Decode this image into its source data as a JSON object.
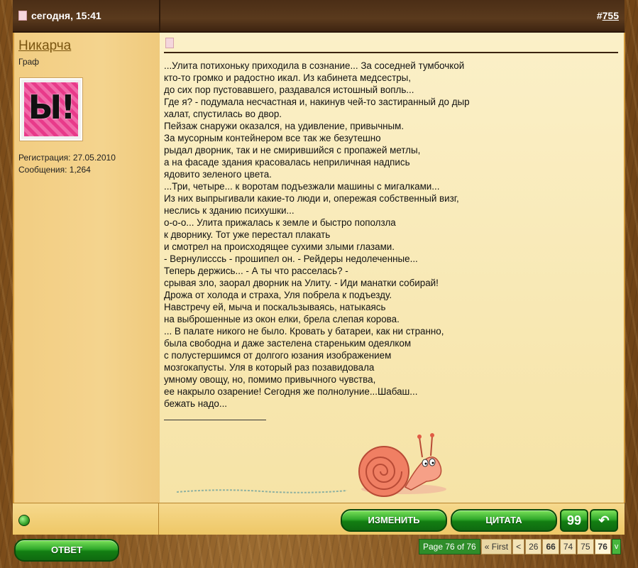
{
  "post": {
    "date": "сегодня, 15:41",
    "number_prefix": "#",
    "number": "755"
  },
  "user": {
    "name": "Никарча",
    "title": "Граф",
    "avatar_text": "Ы!",
    "registration": "Регистрация: 27.05.2010",
    "messages": "Сообщения: 1,264"
  },
  "body": {
    "lines": [
      "...Улита потихоньку приходила в сознание... За соседней тумбочкой",
      "кто-то громко и радостно икал. Из кабинета медсестры,",
      "до сих пор пустовавшего, раздавался истошный вопль...",
      "Где я? - подумала несчастная и, накинув чей-то застиранный до дыр",
      "халат, спустилась во двор.",
      "Пейзаж снаружи оказался, на удивление, привычным.",
      "За мусорным контейнером все так же безутешно",
      "рыдал дворник, так и не смирившийся с пропажей метлы,",
      "а на фасаде здания красовалась неприличная надпись",
      "ядовито зеленого цвета.",
      "...Три, четыре... к воротам подъезжали машины с мигалками...",
      "Из них выпрыгивали какие-то люди и, опережая собственный визг,",
      "неслись к зданию психушки...",
      "о-о-о... Улита прижалась к земле и быстро поползла",
      "к дворнику. Тот уже перестал плакать",
      "и смотрел на происходящее сухими злыми глазами.",
      "- Вернулисссь - прошипел он. - Рейдеры недолеченные...",
      "Теперь держись... - А ты что расселась? -",
      "срывая зло, заорал дворник на Улиту. - Иди манатки собирай!",
      "Дрожа от холода и страха, Уля побрела к подъезду.",
      "Навстречу ей, мыча и поскальзываясь, натыкаясь",
      "на выброшенные из окон елки, брела слепая корова.",
      "... В палате никого не было. Кровать у батареи, как ни странно,",
      "была свободна и даже застелена стареньким одеялком",
      "с полустершимся от долгого юзания изображением",
      "мозгокапусты. Уля в который раз позавидовала",
      "умному овощу, но, помимо привычного чувства,",
      "ее накрыло озарение! Сегодня же полнолуние...Шабаш...",
      "бежать надо..."
    ]
  },
  "buttons": {
    "edit": "ИЗМЕНИТЬ",
    "quote": "ЦИТАТА",
    "multiquote": "99",
    "quick_reply": "↶",
    "reply": "ОТВЕТ"
  },
  "pagenav": {
    "label": "Page 76 of 76",
    "first": "« First",
    "prev": "<",
    "pages": [
      "26",
      "66",
      "74",
      "75",
      "76"
    ],
    "dropdown": "v"
  },
  "colors": {
    "accent_green": "#2fa82a",
    "header_brown": "#4b2e16",
    "username": "#7a5510"
  }
}
